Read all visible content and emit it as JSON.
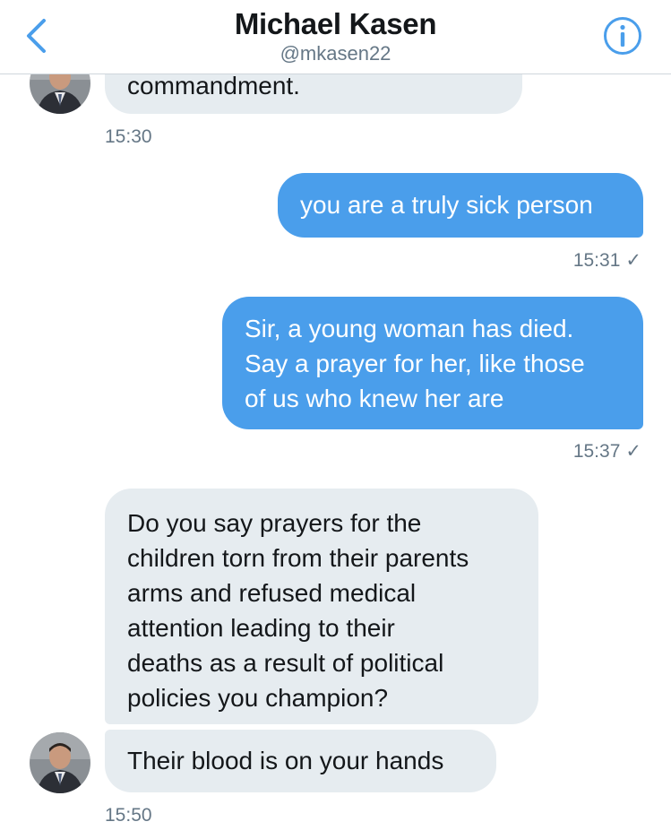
{
  "header": {
    "back_icon": "chevron-left-icon",
    "title": "Michael Kasen",
    "handle": "@mkasen22",
    "info_icon": "info-circle-icon",
    "accent_color": "#4a9eeb"
  },
  "messages": [
    {
      "direction": "incoming",
      "text": "commandment.",
      "time": "15:30"
    },
    {
      "direction": "outgoing",
      "text": "you are a truly sick person",
      "time": "15:31",
      "receipt": "✓"
    },
    {
      "direction": "outgoing",
      "lines": [
        "Sir, a young woman has died.",
        "Say a prayer for her, like those",
        "of us who knew her are"
      ],
      "time": "15:37",
      "receipt": "✓"
    },
    {
      "direction": "incoming",
      "lines": [
        "Do you say prayers for the",
        "children torn from their parents",
        "arms and refused medical",
        "attention leading to their",
        "deaths as a result of political",
        "policies you champion?"
      ]
    },
    {
      "direction": "incoming",
      "text": "Their blood is on your hands",
      "time": "15:50"
    }
  ]
}
